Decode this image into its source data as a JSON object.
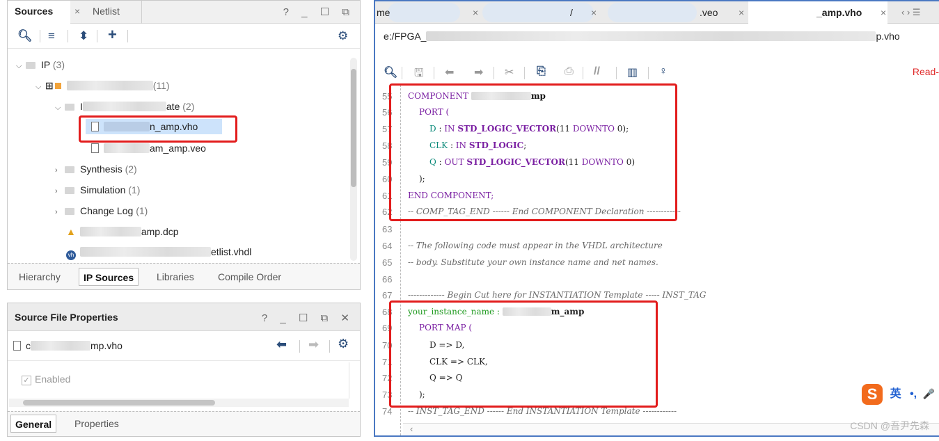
{
  "sources_panel": {
    "tabs": [
      {
        "label": "Sources"
      },
      {
        "label": "Netlist"
      }
    ],
    "tab_close": "×",
    "window_controls": "? _ ☐ ⧉",
    "tree": {
      "ip": {
        "label": "IP",
        "count": "(3)"
      },
      "ip_core": {
        "suffix": "(11)"
      },
      "inst_template": {
        "prefix": "I",
        "suffix": "ate",
        "count": "(2)"
      },
      "file_vho": {
        "suffix": "n_amp.vho"
      },
      "file_veo": {
        "suffix": "am_amp.veo"
      },
      "synthesis": {
        "label": "Synthesis",
        "count": "(2)"
      },
      "simulation": {
        "label": "Simulation",
        "count": "(1)"
      },
      "change_log": {
        "label": "Change Log",
        "count": "(1)"
      },
      "dcp": {
        "suffix": "amp.dcp"
      },
      "netlist": {
        "suffix": "etlist.vhdl"
      }
    },
    "bottom_tabs": [
      {
        "label": "Hierarchy"
      },
      {
        "label": "IP Sources"
      },
      {
        "label": "Libraries"
      },
      {
        "label": "Compile Order"
      }
    ]
  },
  "props_panel": {
    "title": "Source File Properties",
    "window_controls": "? _ ☐ ⧉ ✕",
    "file_prefix": "c",
    "file_suffix": "mp.vho",
    "enabled_label": "Enabled",
    "tabs": [
      {
        "label": "General"
      },
      {
        "label": "Properties"
      }
    ]
  },
  "editor": {
    "tabs": [
      {
        "label": "me"
      },
      {
        "label": "/"
      },
      {
        "label": ".veo"
      },
      {
        "label": "_amp.vho"
      }
    ],
    "tab_close": "×",
    "tab_nav": "‹ › ☰",
    "path_prefix": "e:/FPGA_",
    "path_suffix": "p.vho",
    "read_only": "Read-",
    "lines": [
      {
        "n": "55",
        "text": "COMPONENT"
      },
      {
        "n": "56",
        "text": "PORT ("
      },
      {
        "n": "57",
        "text": "D : IN STD_LOGIC_VECTOR(11 DOWNTO 0);"
      },
      {
        "n": "58",
        "text": "CLK : IN STD_LOGIC;"
      },
      {
        "n": "59",
        "text": "Q : OUT STD_LOGIC_VECTOR(11 DOWNTO 0)"
      },
      {
        "n": "60",
        "text": ");"
      },
      {
        "n": "61",
        "text": "END COMPONENT;"
      },
      {
        "n": "62",
        "text": "-- COMP_TAG_END ------ End COMPONENT Declaration ------------"
      },
      {
        "n": "63",
        "text": ""
      },
      {
        "n": "64",
        "text": "-- The following code must appear in the VHDL architecture"
      },
      {
        "n": "65",
        "text": "-- body. Substitute your own instance name and net names."
      },
      {
        "n": "66",
        "text": ""
      },
      {
        "n": "67",
        "text": "------------- Begin Cut here for INSTANTIATION Template ----- INST_TAG"
      },
      {
        "n": "68",
        "text": "your_instance_name :"
      },
      {
        "n": "69",
        "text": "PORT MAP ("
      },
      {
        "n": "70",
        "text": "D => D,"
      },
      {
        "n": "71",
        "text": "CLK => CLK,"
      },
      {
        "n": "72",
        "text": "Q => Q"
      },
      {
        "n": "73",
        "text": ");"
      },
      {
        "n": "74",
        "text": "-- INST_TAG_END ------ End INSTANTIATION Template ------------"
      }
    ],
    "component_suffix": "mp",
    "instance_suffix": "m_amp",
    "ime": {
      "logo": "S",
      "lang": "英",
      "punct": "•,",
      "mic": "🎤"
    },
    "watermark": "CSDN @吾尹先森"
  },
  "colors": {
    "highlight_box": "#e21c1c",
    "editor_border": "#4a78c2",
    "keyword": "#7a1fa2",
    "identifier": "#0b8a7a"
  }
}
